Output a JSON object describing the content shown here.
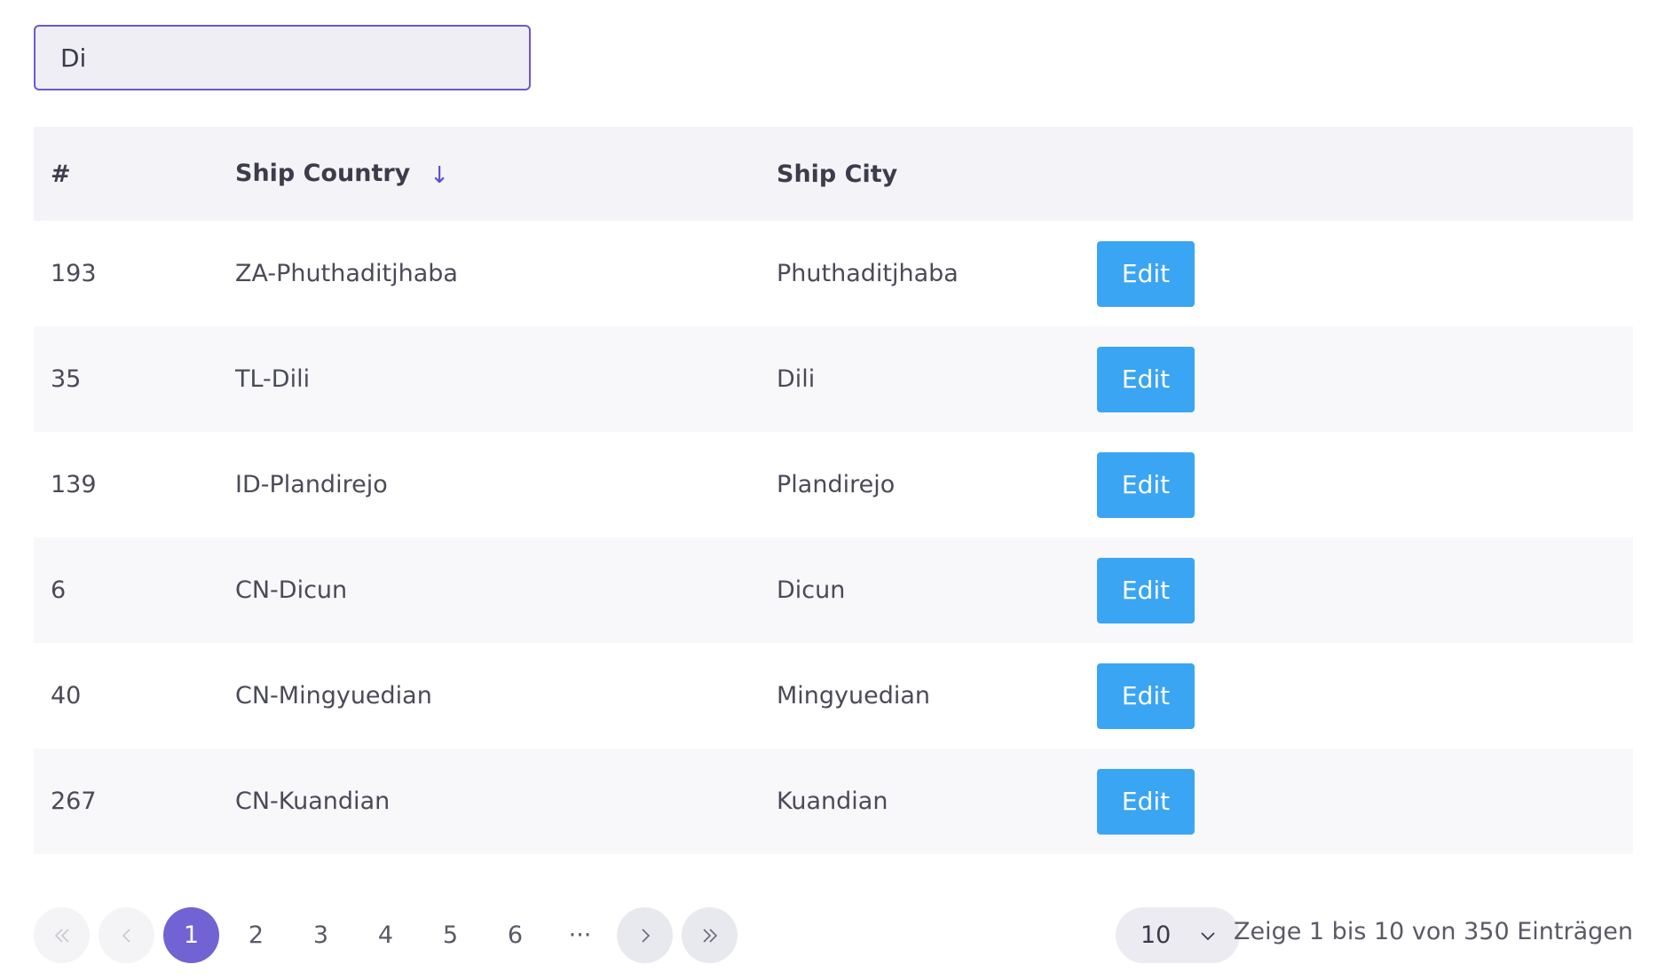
{
  "search": {
    "value": "Di",
    "placeholder": ""
  },
  "table": {
    "headers": {
      "id": "#",
      "country": "Ship Country",
      "city": "Ship City"
    },
    "sort": {
      "column": "Ship Country",
      "direction": "descending"
    },
    "rows": [
      {
        "id": "193",
        "country": "ZA-Phuthaditjhaba",
        "city": "Phuthaditjhaba",
        "action": "Edit"
      },
      {
        "id": "35",
        "country": "TL-Dili",
        "city": "Dili",
        "action": "Edit"
      },
      {
        "id": "139",
        "country": "ID-Plandirejo",
        "city": "Plandirejo",
        "action": "Edit"
      },
      {
        "id": "6",
        "country": "CN-Dicun",
        "city": "Dicun",
        "action": "Edit"
      },
      {
        "id": "40",
        "country": "CN-Mingyuedian",
        "city": "Mingyuedian",
        "action": "Edit"
      },
      {
        "id": "267",
        "country": "CN-Kuandian",
        "city": "Kuandian",
        "action": "Edit"
      }
    ]
  },
  "pagination": {
    "pages": [
      "1",
      "2",
      "3",
      "4",
      "5",
      "6"
    ],
    "current": "1",
    "ellipsis": "···"
  },
  "page_size": {
    "selected": "10"
  },
  "entries_info": "Zeige 1 bis 10 von 350 Einträgen",
  "colors": {
    "accent": "#7163d3",
    "edit_button": "#3aa5f2",
    "input_border": "#6a5acd"
  }
}
